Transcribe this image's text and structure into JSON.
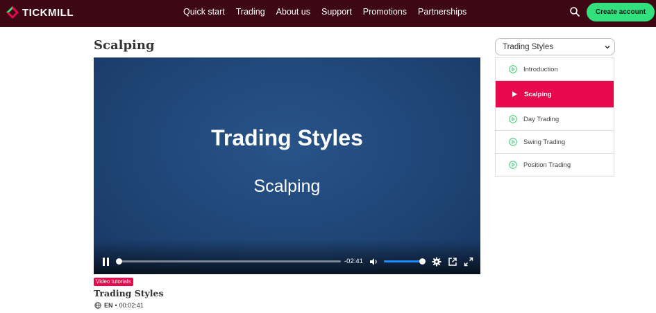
{
  "brand": {
    "name": "TICKMILL",
    "accent": "#32e07e",
    "highlight": "#e8094d",
    "header_bg": "#3d0814"
  },
  "nav": {
    "items": [
      {
        "label": "Quick start"
      },
      {
        "label": "Trading"
      },
      {
        "label": "About us"
      },
      {
        "label": "Support"
      },
      {
        "label": "Promotions"
      },
      {
        "label": "Partnerships"
      }
    ],
    "search_icon": "search-icon",
    "cta_label": "Create account"
  },
  "page": {
    "title": "Scalping"
  },
  "player": {
    "slide_title": "Trading Styles",
    "slide_subtitle": "Scalping",
    "time_remaining": "-02:41",
    "progress_fraction": 0,
    "volume_fraction": 1,
    "icons": [
      "pause-icon",
      "volume-icon",
      "settings-icon",
      "popout-icon",
      "fullscreen-icon"
    ]
  },
  "video_info": {
    "badge": "Video tutorials",
    "title": "Trading Styles",
    "language": "EN",
    "separator": "•",
    "duration": "00:02:41"
  },
  "sidebar": {
    "select_value": "Trading Styles",
    "items": [
      {
        "label": "Introduction",
        "active": false
      },
      {
        "label": "Scalping",
        "active": true
      },
      {
        "label": "Day Trading",
        "active": false
      },
      {
        "label": "Swing Trading",
        "active": false
      },
      {
        "label": "Position Trading",
        "active": false
      }
    ]
  }
}
